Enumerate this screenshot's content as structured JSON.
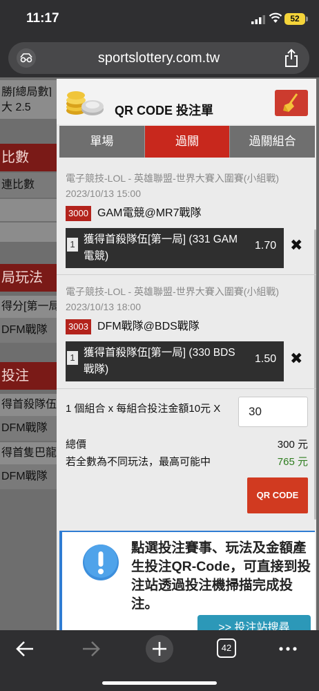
{
  "status_bar": {
    "time": "11:17",
    "battery": "52"
  },
  "browser": {
    "url": "sportslottery.com.tw",
    "tabs_count": "42"
  },
  "background_page": {
    "rows": [
      "勝[總局數]",
      "大 2.5",
      "比數",
      "連比數",
      "局玩法",
      "得分[第一局]",
      "DFM戰隊",
      "投注",
      "得首殺隊伍[",
      "DFM戰隊",
      "得首隻巴龍隊",
      "DFM戰隊"
    ]
  },
  "panel": {
    "title": "QR CODE 投注單",
    "tabs": [
      "單場",
      "過關",
      "過關組合"
    ],
    "active_tab": "過關",
    "bets": [
      {
        "event": "電子競技-LOL - 英雄聯盟-世界大賽入圍賽(小組戰)",
        "date": "2023/10/13 15:00",
        "code": "3000",
        "match": "GAM電競@MR7戰隊",
        "pick_num": "1",
        "pick": "獲得首殺隊伍[第一局] (331 GAM 電競)",
        "odds": "1.70"
      },
      {
        "event": "電子競技-LOL - 英雄聯盟-世界大賽入圍賽(小組戰)",
        "date": "2023/10/13 18:00",
        "code": "3003",
        "match": "DFM戰隊@BDS戰隊",
        "pick_num": "1",
        "pick": "獲得首殺隊伍[第一局] (330 BDS 戰隊)",
        "odds": "1.50"
      }
    ],
    "summary": "1 個組合 x 每組合投注金額10元 X",
    "amount": "30",
    "total_label": "總價",
    "total_value": "300 元",
    "max_win_label": "若全數為不同玩法，最高可能中",
    "max_win_value": "765 元",
    "qr_button": "QR CODE",
    "info_text": "點選投注賽事、玩法及金額產生投注QR-Code，可直接到投注站透過投注機掃描完成投注。",
    "locator_button": ">> 投注站搜尋"
  },
  "colors": {
    "accent_red": "#c8281d",
    "win_green": "#2e7d1f",
    "info_blue": "#2f7cd3"
  }
}
